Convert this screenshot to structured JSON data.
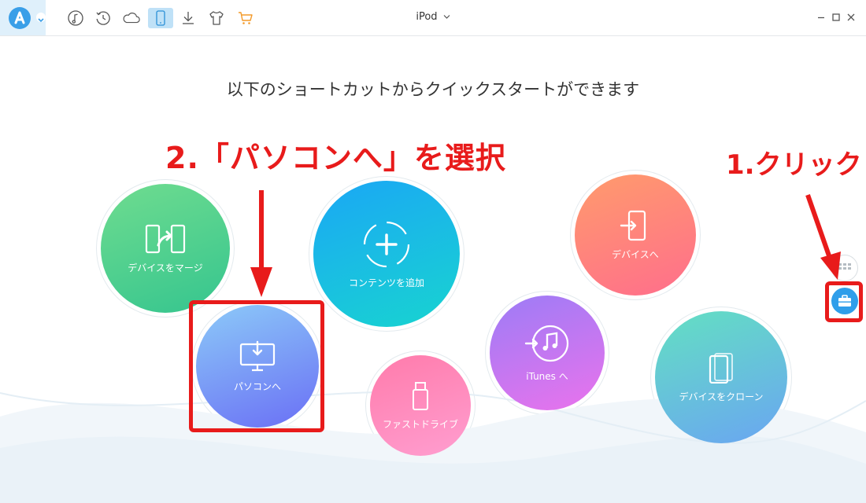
{
  "header": {
    "device_name": "iPod",
    "toolbar_icons": [
      "music-note-icon",
      "history-icon",
      "cloud-icon",
      "phone-icon",
      "download-icon",
      "tshirt-icon",
      "cart-icon"
    ],
    "window_controls": [
      "minimize-icon",
      "maximize-icon",
      "close-icon"
    ]
  },
  "main": {
    "heading": "以下のショートカットからクイックスタートができます",
    "shortcuts": [
      {
        "label": "デバイスをマージ",
        "icon": "merge-devices-icon",
        "color_from": "#6fdc8f",
        "color_to": "#35c58f"
      },
      {
        "label": "コンテンツを追加",
        "icon": "add-content-icon",
        "color_from": "#1ba7f5",
        "color_to": "#18d4d0"
      },
      {
        "label": "パソコンへ",
        "icon": "to-computer-icon",
        "color_from": "#8ccaf8",
        "color_to": "#6a6ff5"
      },
      {
        "label": "ファストドライブ",
        "icon": "usb-drive-icon",
        "color_from": "#ff7bab",
        "color_to": "#ff9ed0"
      },
      {
        "label": "iTunes へ",
        "icon": "itunes-icon",
        "color_from": "#9c7cf6",
        "color_to": "#ea73ec"
      },
      {
        "label": "デバイスへ",
        "icon": "to-device-icon",
        "color_from": "#ff9b6c",
        "color_to": "#ff6e8c"
      },
      {
        "label": "デバイスをクローン",
        "icon": "clone-device-icon",
        "color_from": "#63e0c2",
        "color_to": "#6aa5f2"
      }
    ]
  },
  "side_buttons": [
    {
      "icon": "grid-icon"
    },
    {
      "icon": "toolbox-icon",
      "color": "#2f9eea"
    }
  ],
  "annotations": {
    "step1": "1.クリック",
    "step2": "2.「パソコンへ」を選択",
    "color": "#e81b1b"
  }
}
